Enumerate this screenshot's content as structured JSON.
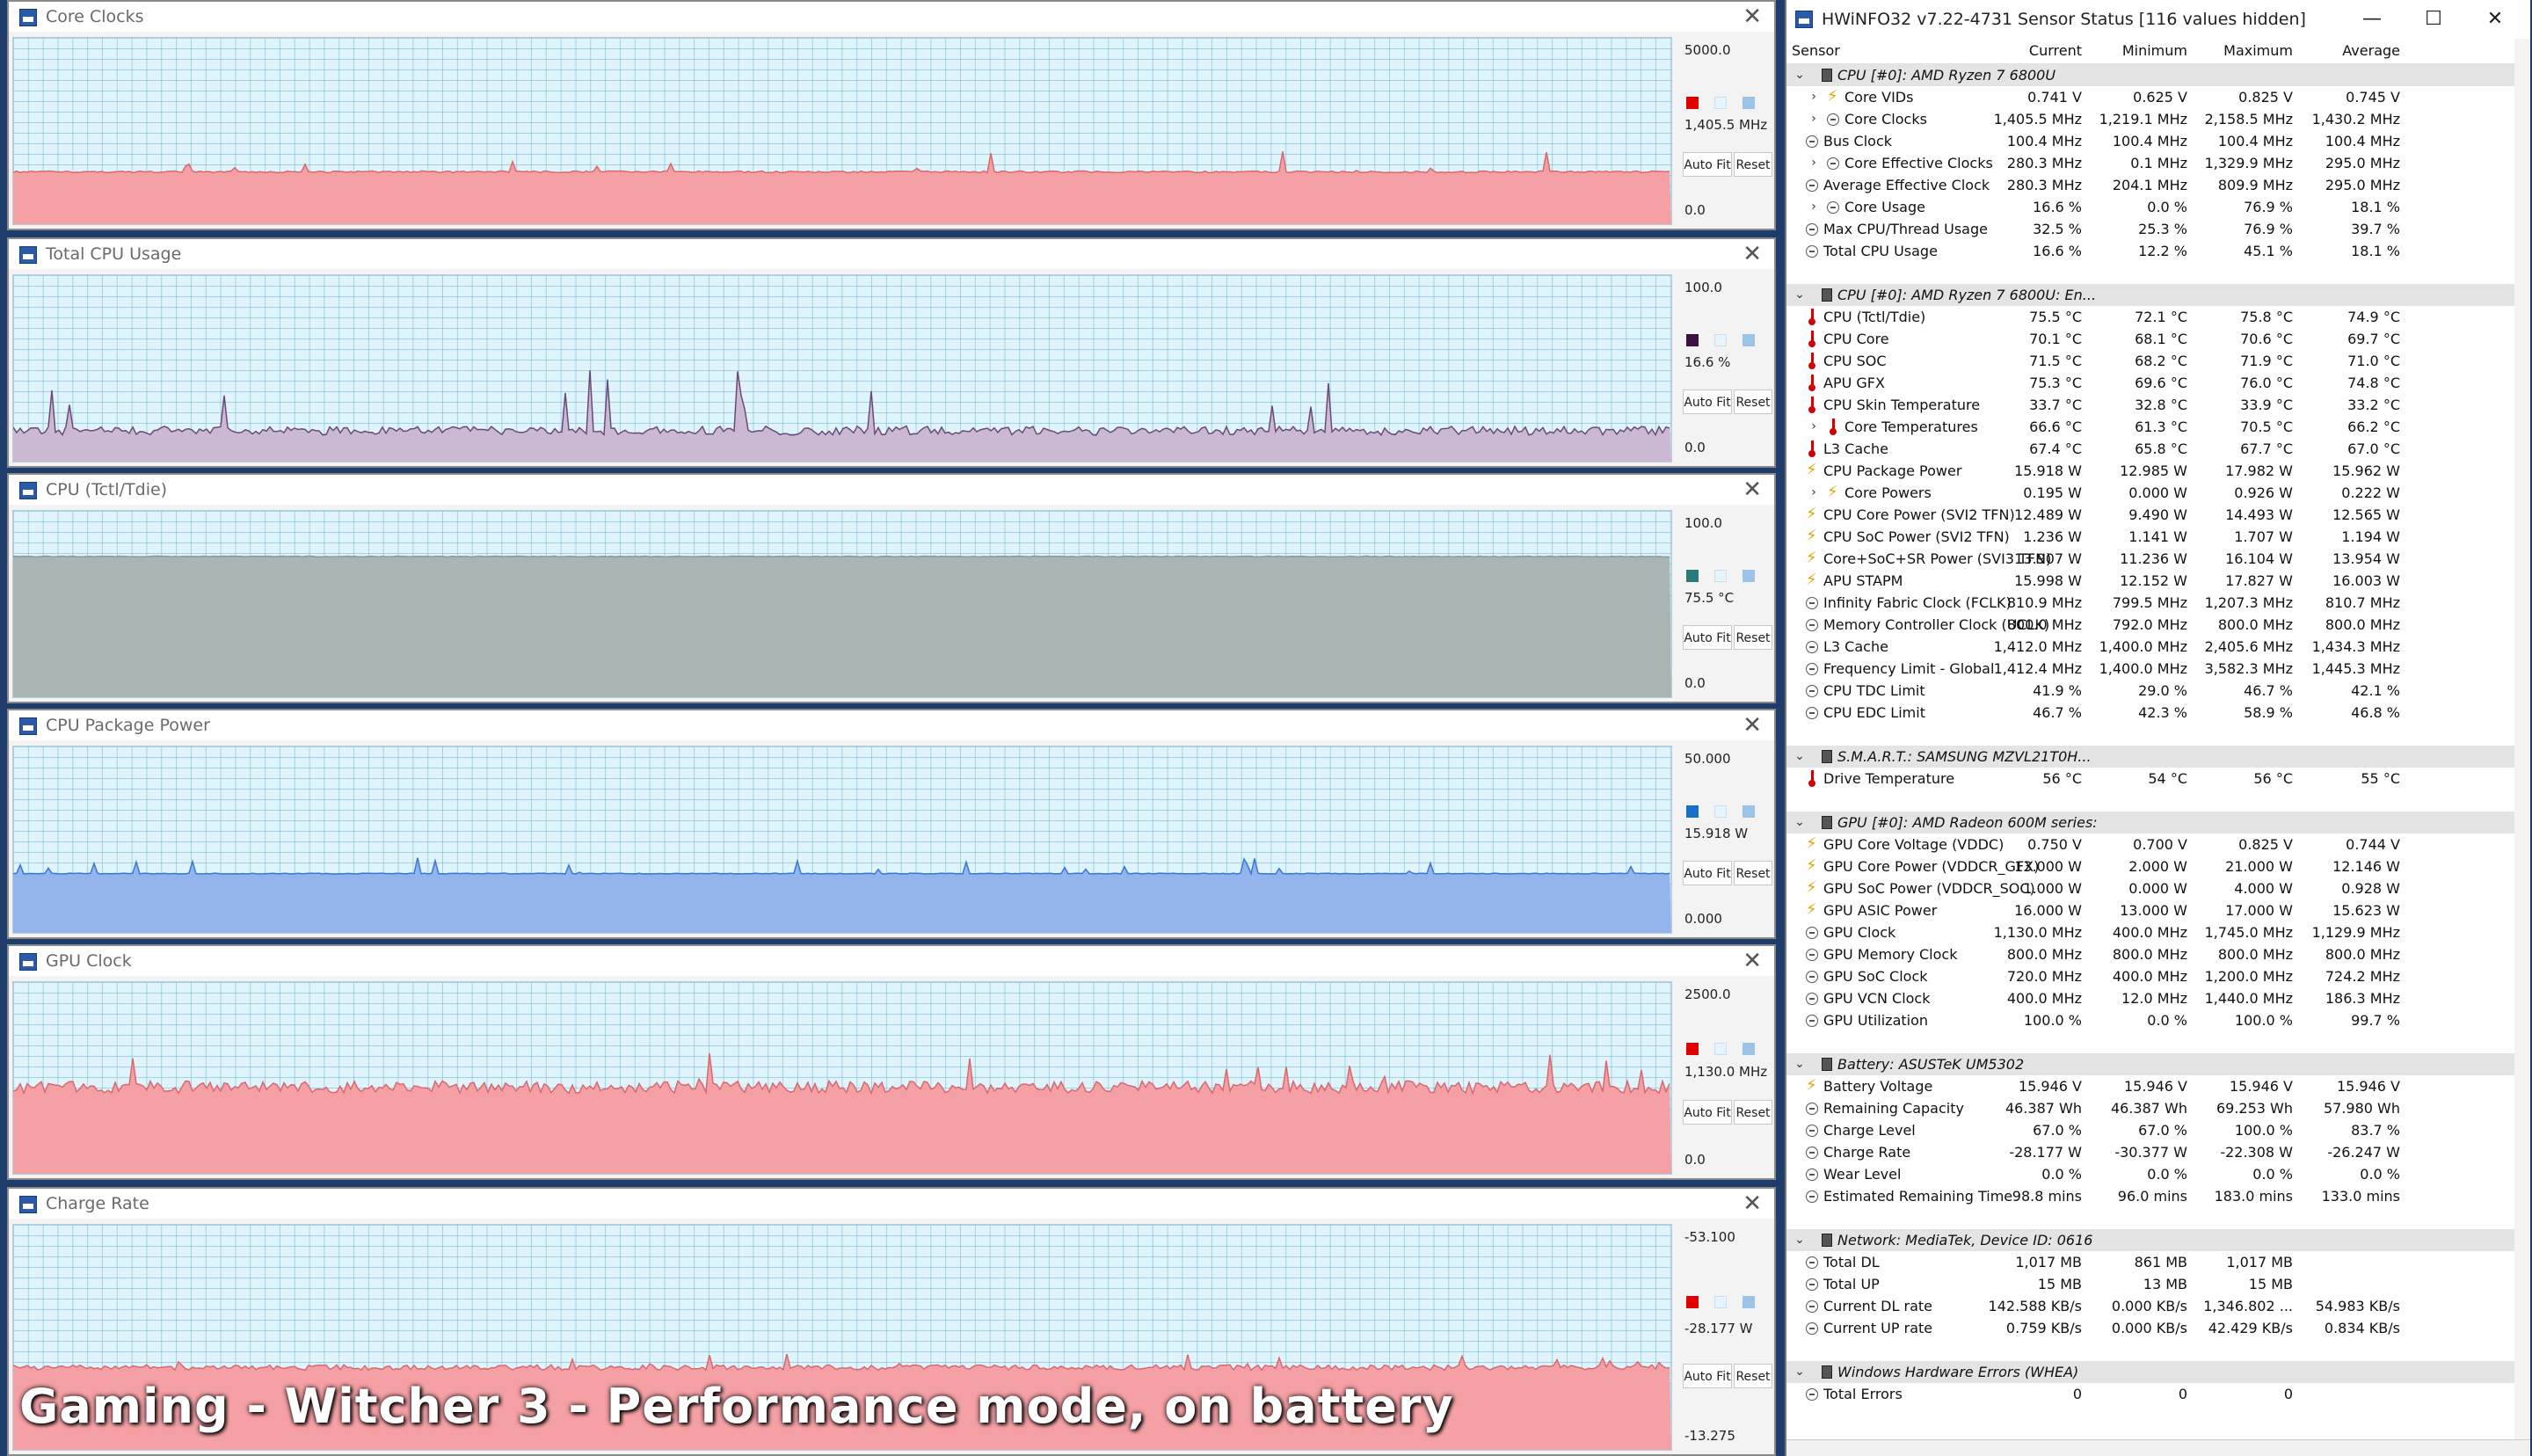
{
  "overlay_caption": "Gaming - Witcher 3 - Performance mode, on battery",
  "common": {
    "auto_fit": "Auto Fit",
    "reset": "Reset"
  },
  "graphs": [
    {
      "title": "Core Clocks",
      "max": "5000.0",
      "current": "1,405.5 MHz",
      "min": "0.0",
      "color": "#e00000",
      "fill": "#f4a0a4",
      "line": "#d86870",
      "level": 0.281
    },
    {
      "title": "Total CPU Usage",
      "max": "100.0",
      "current": "16.6 %",
      "min": "0.0",
      "color": "#3c1040",
      "fill": "#cbb9d3",
      "line": "#6a4a7a",
      "level": 0.166
    },
    {
      "title": "CPU (Tctl/Tdie)",
      "max": "100.0",
      "current": "75.5 °C",
      "min": "0.0",
      "color": "#2a7a7a",
      "fill": "#aab4b2",
      "line": "#8a9896",
      "level": 0.755
    },
    {
      "title": "CPU Package Power",
      "max": "50.000",
      "current": "15.918 W",
      "min": "0.000",
      "color": "#1a70c8",
      "fill": "#94b4ec",
      "line": "#3a78d8",
      "level": 0.318
    },
    {
      "title": "GPU Clock",
      "max": "2500.0",
      "current": "1,130.0 MHz",
      "min": "0.0",
      "color": "#e00000",
      "fill": "#f4a0a4",
      "line": "#d86870",
      "level": 0.452
    },
    {
      "title": "Charge Rate",
      "max": "-53.100",
      "current": "-28.177 W",
      "min": "-13.275",
      "color": "#e00000",
      "fill": "#f4a0a4",
      "line": "#d86870",
      "level": 0.366
    }
  ],
  "sensor_window": {
    "title": "HWiNFO32 v7.22-4731 Sensor Status [116 values hidden]",
    "columns": [
      "Sensor",
      "Current",
      "Minimum",
      "Maximum",
      "Average"
    ],
    "rows": [
      {
        "type": "group",
        "label": "CPU [#0]: AMD Ryzen 7 6800U"
      },
      {
        "type": "item",
        "icon": "bolt",
        "expand": true,
        "label": "Core VIDs",
        "v": [
          "0.741 V",
          "0.625 V",
          "0.825 V",
          "0.745 V"
        ]
      },
      {
        "type": "item",
        "icon": "clock",
        "expand": true,
        "label": "Core Clocks",
        "v": [
          "1,405.5 MHz",
          "1,219.1 MHz",
          "2,158.5 MHz",
          "1,430.2 MHz"
        ]
      },
      {
        "type": "item",
        "icon": "clock",
        "label": "Bus Clock",
        "v": [
          "100.4 MHz",
          "100.4 MHz",
          "100.4 MHz",
          "100.4 MHz"
        ]
      },
      {
        "type": "item",
        "icon": "clock",
        "expand": true,
        "label": "Core Effective Clocks",
        "v": [
          "280.3 MHz",
          "0.1 MHz",
          "1,329.9 MHz",
          "295.0 MHz"
        ]
      },
      {
        "type": "item",
        "icon": "clock",
        "label": "Average Effective Clock",
        "v": [
          "280.3 MHz",
          "204.1 MHz",
          "809.9 MHz",
          "295.0 MHz"
        ]
      },
      {
        "type": "item",
        "icon": "clock",
        "expand": true,
        "label": "Core Usage",
        "v": [
          "16.6 %",
          "0.0 %",
          "76.9 %",
          "18.1 %"
        ]
      },
      {
        "type": "item",
        "icon": "clock",
        "label": "Max CPU/Thread Usage",
        "v": [
          "32.5 %",
          "25.3 %",
          "76.9 %",
          "39.7 %"
        ]
      },
      {
        "type": "item",
        "icon": "clock",
        "label": "Total CPU Usage",
        "v": [
          "16.6 %",
          "12.2 %",
          "45.1 %",
          "18.1 %"
        ]
      },
      {
        "type": "blank"
      },
      {
        "type": "group",
        "label": "CPU [#0]: AMD Ryzen 7 6800U: En..."
      },
      {
        "type": "item",
        "icon": "therm",
        "label": "CPU (Tctl/Tdie)",
        "v": [
          "75.5 °C",
          "72.1 °C",
          "75.8 °C",
          "74.9 °C"
        ]
      },
      {
        "type": "item",
        "icon": "therm",
        "label": "CPU Core",
        "v": [
          "70.1 °C",
          "68.1 °C",
          "70.6 °C",
          "69.7 °C"
        ]
      },
      {
        "type": "item",
        "icon": "therm",
        "label": "CPU SOC",
        "v": [
          "71.5 °C",
          "68.2 °C",
          "71.9 °C",
          "71.0 °C"
        ]
      },
      {
        "type": "item",
        "icon": "therm",
        "label": "APU GFX",
        "v": [
          "75.3 °C",
          "69.6 °C",
          "76.0 °C",
          "74.8 °C"
        ]
      },
      {
        "type": "item",
        "icon": "therm",
        "label": "CPU Skin Temperature",
        "v": [
          "33.7 °C",
          "32.8 °C",
          "33.9 °C",
          "33.2 °C"
        ]
      },
      {
        "type": "item",
        "icon": "therm",
        "expand": true,
        "label": "Core Temperatures",
        "v": [
          "66.6 °C",
          "61.3 °C",
          "70.5 °C",
          "66.2 °C"
        ]
      },
      {
        "type": "item",
        "icon": "therm",
        "label": "L3 Cache",
        "v": [
          "67.4 °C",
          "65.8 °C",
          "67.7 °C",
          "67.0 °C"
        ]
      },
      {
        "type": "item",
        "icon": "bolt",
        "label": "CPU Package Power",
        "v": [
          "15.918 W",
          "12.985 W",
          "17.982 W",
          "15.962 W"
        ]
      },
      {
        "type": "item",
        "icon": "bolt",
        "expand": true,
        "label": "Core Powers",
        "v": [
          "0.195 W",
          "0.000 W",
          "0.926 W",
          "0.222 W"
        ]
      },
      {
        "type": "item",
        "icon": "bolt",
        "label": "CPU Core Power (SVI2 TFN)",
        "v": [
          "12.489 W",
          "9.490 W",
          "14.493 W",
          "12.565 W"
        ]
      },
      {
        "type": "item",
        "icon": "bolt",
        "label": "CPU SoC Power (SVI2 TFN)",
        "v": [
          "1.236 W",
          "1.141 W",
          "1.707 W",
          "1.194 W"
        ]
      },
      {
        "type": "item",
        "icon": "bolt",
        "label": "Core+SoC+SR Power (SVI3 TFN)",
        "v": [
          "13.907 W",
          "11.236 W",
          "16.104 W",
          "13.954 W"
        ]
      },
      {
        "type": "item",
        "icon": "bolt",
        "label": "APU STAPM",
        "v": [
          "15.998 W",
          "12.152 W",
          "17.827 W",
          "16.003 W"
        ]
      },
      {
        "type": "item",
        "icon": "clock",
        "label": "Infinity Fabric Clock (FCLK)",
        "v": [
          "810.9 MHz",
          "799.5 MHz",
          "1,207.3 MHz",
          "810.7 MHz"
        ]
      },
      {
        "type": "item",
        "icon": "clock",
        "label": "Memory Controller Clock (UCLK)",
        "v": [
          "800.0 MHz",
          "792.0 MHz",
          "800.0 MHz",
          "800.0 MHz"
        ]
      },
      {
        "type": "item",
        "icon": "clock",
        "label": "L3 Cache",
        "v": [
          "1,412.0 MHz",
          "1,400.0 MHz",
          "2,405.6 MHz",
          "1,434.3 MHz"
        ]
      },
      {
        "type": "item",
        "icon": "clock",
        "label": "Frequency Limit - Global",
        "v": [
          "1,412.4 MHz",
          "1,400.0 MHz",
          "3,582.3 MHz",
          "1,445.3 MHz"
        ]
      },
      {
        "type": "item",
        "icon": "clock",
        "label": "CPU TDC Limit",
        "v": [
          "41.9 %",
          "29.0 %",
          "46.7 %",
          "42.1 %"
        ]
      },
      {
        "type": "item",
        "icon": "clock",
        "label": "CPU EDC Limit",
        "v": [
          "46.7 %",
          "42.3 %",
          "58.9 %",
          "46.8 %"
        ]
      },
      {
        "type": "blank"
      },
      {
        "type": "group",
        "label": "S.M.A.R.T.: SAMSUNG MZVL21T0H..."
      },
      {
        "type": "item",
        "icon": "therm",
        "label": "Drive Temperature",
        "v": [
          "56 °C",
          "54 °C",
          "56 °C",
          "55 °C"
        ]
      },
      {
        "type": "blank"
      },
      {
        "type": "group",
        "label": "GPU [#0]: AMD Radeon 600M series:"
      },
      {
        "type": "item",
        "icon": "bolt",
        "label": "GPU Core Voltage (VDDC)",
        "v": [
          "0.750 V",
          "0.700 V",
          "0.825 V",
          "0.744 V"
        ]
      },
      {
        "type": "item",
        "icon": "bolt",
        "label": "GPU Core Power (VDDCR_GFX)",
        "v": [
          "13.000 W",
          "2.000 W",
          "21.000 W",
          "12.146 W"
        ]
      },
      {
        "type": "item",
        "icon": "bolt",
        "label": "GPU SoC Power (VDDCR_SOC)",
        "v": [
          "1.000 W",
          "0.000 W",
          "4.000 W",
          "0.928 W"
        ]
      },
      {
        "type": "item",
        "icon": "bolt",
        "label": "GPU ASIC Power",
        "v": [
          "16.000 W",
          "13.000 W",
          "17.000 W",
          "15.623 W"
        ]
      },
      {
        "type": "item",
        "icon": "clock",
        "label": "GPU Clock",
        "v": [
          "1,130.0 MHz",
          "400.0 MHz",
          "1,745.0 MHz",
          "1,129.9 MHz"
        ]
      },
      {
        "type": "item",
        "icon": "clock",
        "label": "GPU Memory Clock",
        "v": [
          "800.0 MHz",
          "800.0 MHz",
          "800.0 MHz",
          "800.0 MHz"
        ]
      },
      {
        "type": "item",
        "icon": "clock",
        "label": "GPU SoC Clock",
        "v": [
          "720.0 MHz",
          "400.0 MHz",
          "1,200.0 MHz",
          "724.2 MHz"
        ]
      },
      {
        "type": "item",
        "icon": "clock",
        "label": "GPU VCN Clock",
        "v": [
          "400.0 MHz",
          "12.0 MHz",
          "1,440.0 MHz",
          "186.3 MHz"
        ]
      },
      {
        "type": "item",
        "icon": "clock",
        "label": "GPU Utilization",
        "v": [
          "100.0 %",
          "0.0 %",
          "100.0 %",
          "99.7 %"
        ]
      },
      {
        "type": "blank"
      },
      {
        "type": "group",
        "label": "Battery: ASUSTeK UM5302"
      },
      {
        "type": "item",
        "icon": "bolt",
        "label": "Battery Voltage",
        "v": [
          "15.946 V",
          "15.946 V",
          "15.946 V",
          "15.946 V"
        ]
      },
      {
        "type": "item",
        "icon": "clock",
        "label": "Remaining Capacity",
        "v": [
          "46.387 Wh",
          "46.387 Wh",
          "69.253 Wh",
          "57.980 Wh"
        ]
      },
      {
        "type": "item",
        "icon": "clock",
        "label": "Charge Level",
        "v": [
          "67.0 %",
          "67.0 %",
          "100.0 %",
          "83.7 %"
        ]
      },
      {
        "type": "item",
        "icon": "clock",
        "label": "Charge Rate",
        "v": [
          "-28.177 W",
          "-30.377 W",
          "-22.308 W",
          "-26.247 W"
        ]
      },
      {
        "type": "item",
        "icon": "clock",
        "label": "Wear Level",
        "v": [
          "0.0 %",
          "0.0 %",
          "0.0 %",
          "0.0 %"
        ]
      },
      {
        "type": "item",
        "icon": "clock",
        "label": "Estimated Remaining Time",
        "v": [
          "98.8 mins",
          "96.0 mins",
          "183.0 mins",
          "133.0 mins"
        ]
      },
      {
        "type": "blank"
      },
      {
        "type": "group",
        "label": "Network: MediaTek, Device ID: 0616"
      },
      {
        "type": "item",
        "icon": "clock",
        "label": "Total DL",
        "v": [
          "1,017 MB",
          "861 MB",
          "1,017 MB",
          ""
        ]
      },
      {
        "type": "item",
        "icon": "clock",
        "label": "Total UP",
        "v": [
          "15 MB",
          "13 MB",
          "15 MB",
          ""
        ]
      },
      {
        "type": "item",
        "icon": "clock",
        "label": "Current DL rate",
        "v": [
          "142.588 KB/s",
          "0.000 KB/s",
          "1,346.802 ...",
          "54.983 KB/s"
        ]
      },
      {
        "type": "item",
        "icon": "clock",
        "label": "Current UP rate",
        "v": [
          "0.759 KB/s",
          "0.000 KB/s",
          "42.429 KB/s",
          "0.834 KB/s"
        ]
      },
      {
        "type": "blank"
      },
      {
        "type": "group",
        "label": "Windows Hardware Errors (WHEA)"
      },
      {
        "type": "item",
        "icon": "clock",
        "label": "Total Errors",
        "v": [
          "0",
          "0",
          "0",
          ""
        ]
      }
    ]
  }
}
